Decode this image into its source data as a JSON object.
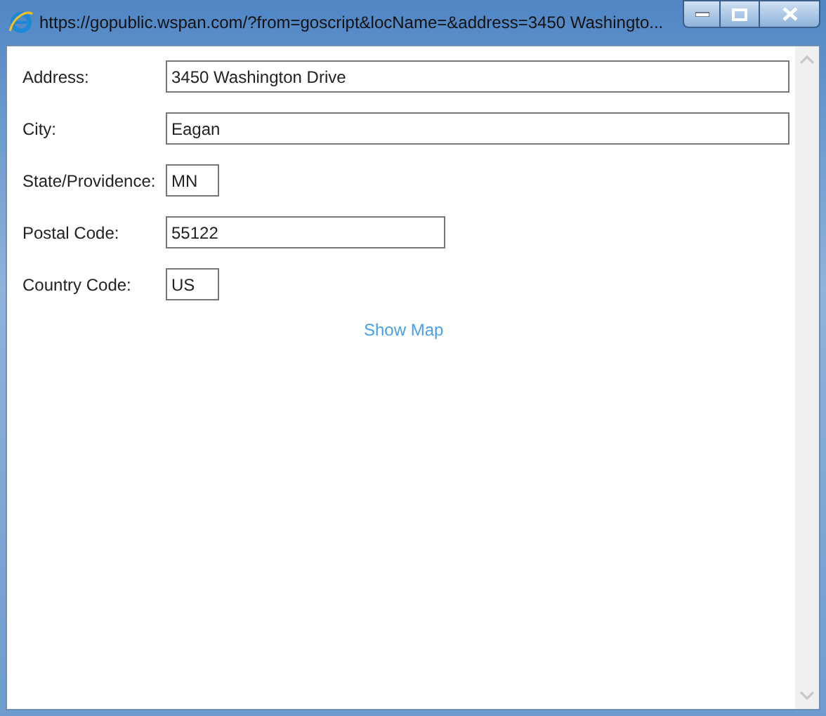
{
  "window": {
    "title": "https://gopublic.wspan.com/?from=goscript&locName=&address=3450 Washingto..."
  },
  "fields": [
    {
      "label": "Address:",
      "value": "3450 Washington Drive",
      "kind": "long"
    },
    {
      "label": "City:",
      "value": "Eagan",
      "kind": "long"
    },
    {
      "label": "State/Providence:",
      "value": "MN",
      "kind": "short"
    },
    {
      "label": "Postal Code:",
      "value": "55122",
      "kind": "medium"
    },
    {
      "label": "Country Code:",
      "value": "US",
      "kind": "short"
    }
  ],
  "link": "Show Map"
}
